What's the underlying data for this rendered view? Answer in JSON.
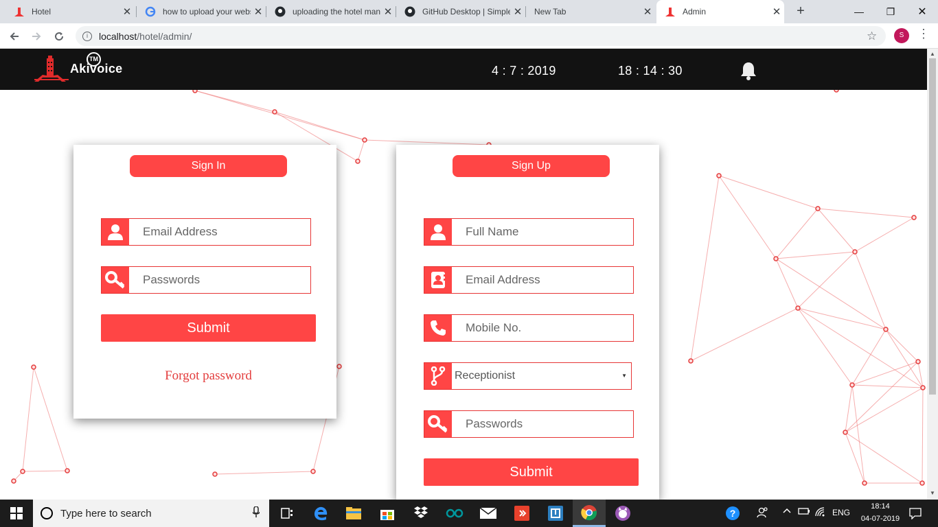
{
  "browser": {
    "tabs": [
      {
        "title": "Hotel",
        "icon": "hotel-favicon",
        "active": false
      },
      {
        "title": "how to upload your website",
        "icon": "google-favicon",
        "active": false
      },
      {
        "title": "uploading the hotel management",
        "icon": "github-favicon",
        "active": false
      },
      {
        "title": "GitHub Desktop | Simple",
        "icon": "github-favicon",
        "active": false
      },
      {
        "title": "New Tab",
        "icon": "",
        "active": false
      },
      {
        "title": "Admin",
        "icon": "hotel-favicon",
        "active": true
      }
    ],
    "url_host": "localhost",
    "url_path": "/hotel/admin/",
    "profile_initial": "S"
  },
  "header": {
    "logo_text": "Akivoice",
    "tm": "TM",
    "date": "4 : 7 : 2019",
    "time": "18 : 14 : 30"
  },
  "signin": {
    "title": "Sign In",
    "email_placeholder": "Email Address",
    "password_placeholder": "Passwords",
    "submit": "Submit",
    "forgot": "Forgot password"
  },
  "signup": {
    "title": "Sign Up",
    "name_placeholder": "Full Name",
    "email_placeholder": "Email Address",
    "mobile_placeholder": "Mobile No.",
    "role_selected": "Receptionist",
    "password_placeholder": "Passwords",
    "submit": "Submit"
  },
  "taskbar": {
    "search_placeholder": "Type here to search",
    "language": "ENG",
    "time": "18:14",
    "date": "04-07-2019"
  },
  "colors": {
    "accent": "#ff4545",
    "header_bg": "#121212",
    "network_line": "#f28b8b"
  }
}
